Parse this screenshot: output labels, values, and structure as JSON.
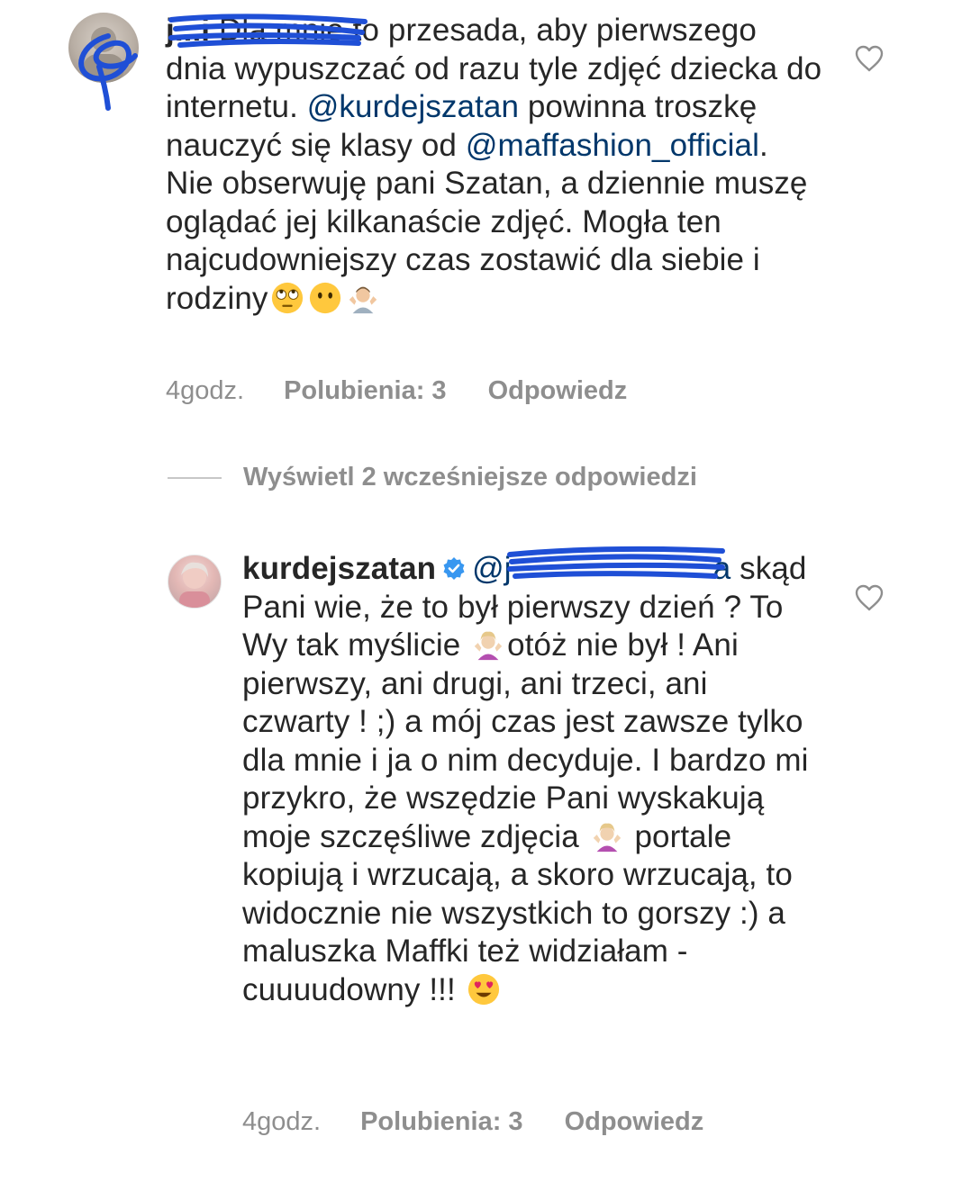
{
  "comments": [
    {
      "username": "j...i",
      "body_parts": {
        "p1": "Dla mnie to przesada, aby pierwszego dnia wypuszczać od razu tyle zdjęć dziecka do internetu. ",
        "mention1": "@kurdejszatan",
        "p2": " powinna troszkę nauczyć się klasy od ",
        "mention2": "@maffashion_official",
        "p3": ". Nie obserwuję pani Szatan, a dziennie muszę oglądać jej kilkanaście zdjęć. Mogła ten najcudowniejszy czas zostawić dla siebie i rodziny"
      },
      "emojis": [
        "face-with-rolling-eyes-emoji",
        "face-without-mouth-emoji",
        "man-shrugging-emoji"
      ],
      "time": "4godz.",
      "likes": "Polubienia: 3",
      "reply": "Odpowiedz",
      "liked": false
    },
    {
      "username": "kurdejszatan",
      "verified": true,
      "mention_visible": "@j",
      "mention_tail": "a",
      "body_parts": {
        "p1": "skąd Pani wie, że to był pierwszy dzień ? To Wy tak myślicie ",
        "p2": "otóż nie był ! Ani pierwszy, ani drugi, ani trzeci, ani czwarty ! ;) a mój czas jest zawsze tylko dla mnie i ja o nim decyduje. I bardzo mi przykro, że wszędzie Pani wyskakują moje szczęśliwe zdjęcia ",
        "p3": " portale kopiują i wrzucają, a skoro wrzucają, to widocznie nie wszystkich to gorszy :) a maluszka Maffki też widziałam - cuuuudowny !!! "
      },
      "emojis": [
        "woman-shrugging-emoji",
        "woman-shrugging-emoji",
        "smiling-face-with-heart-eyes-emoji"
      ],
      "time": "4godz.",
      "likes": "Polubienia: 3",
      "reply": "Odpowiedz",
      "liked": false
    }
  ],
  "replies_toggle": "Wyświetl 2 wcześniejsze odpowiedzi",
  "colors": {
    "text": "#262626",
    "mention": "#00376b",
    "meta": "#8e8e8e",
    "redaction": "#1f4fd6",
    "verified": "#3897f0"
  },
  "icons": [
    "heart-outline-icon",
    "verified-badge-icon"
  ]
}
